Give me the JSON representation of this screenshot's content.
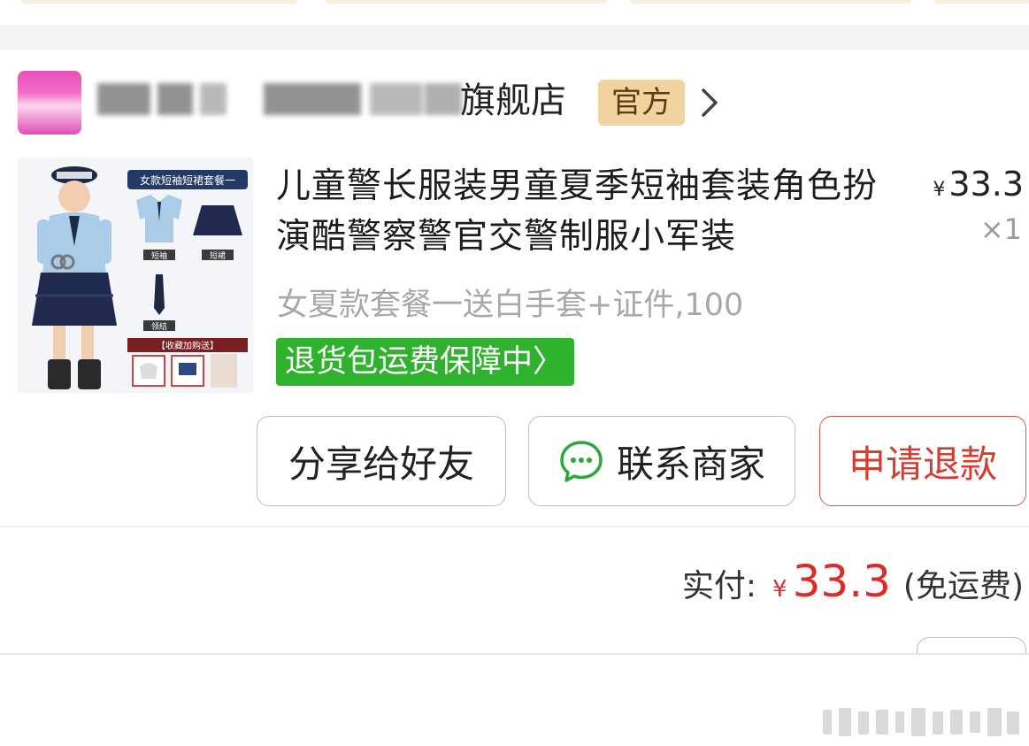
{
  "store": {
    "name_visible": "旗舰店",
    "badge": "官方"
  },
  "product": {
    "title": "儿童警长服装男童夏季短袖套装角色扮演酷警察警官交警制服小军装",
    "price_symbol": "¥",
    "price": "33.3",
    "quantity": "×1",
    "sku": "女夏款套餐一送白手套+证件,100",
    "guarantee": "退货包运费保障中〉",
    "image": {
      "banner": "女款短袖短裙套餐一",
      "labels": [
        "短袖",
        "短裙",
        "领结"
      ],
      "gift_banner": "【收藏加购送】"
    }
  },
  "actions": {
    "share": "分享给好友",
    "contact": "联系商家",
    "refund": "申请退款"
  },
  "total": {
    "label": "实付:",
    "symbol": "¥",
    "amount": "33.3",
    "shipping": "(免运费)"
  },
  "colors": {
    "price_red": "#e02a2a",
    "guarantee_green": "#2fb32f",
    "badge_gold": "#f1d3a0",
    "refund_red": "#d83b2f",
    "wechat_green": "#2ca83a"
  }
}
